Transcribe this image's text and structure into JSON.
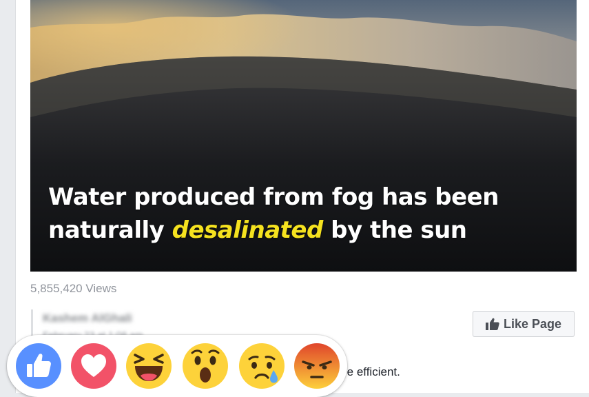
{
  "video": {
    "caption_before": "Water produced from fog has been naturally",
    "caption_highlight": "desalinated",
    "caption_after": "by the sun"
  },
  "views": "5,855,420 Views",
  "author": {
    "name": "Kashem AlGhali",
    "date": "February 23 at 1:08 am"
  },
  "like_page_button": "Like Page",
  "body_text_fragment": "re efficient.",
  "reactions": [
    {
      "name": "like",
      "icon": "like-reaction-icon",
      "color": "#5890ff"
    },
    {
      "name": "love",
      "icon": "love-reaction-icon",
      "color": "#f25268"
    },
    {
      "name": "haha",
      "icon": "haha-reaction-icon",
      "color": "#fdd23a"
    },
    {
      "name": "wow",
      "icon": "wow-reaction-icon",
      "color": "#fdd23a"
    },
    {
      "name": "sad",
      "icon": "sad-reaction-icon",
      "color": "#fdd23a"
    },
    {
      "name": "angry",
      "icon": "angry-reaction-icon",
      "color": "#f26b2e"
    }
  ],
  "colors": {
    "caption_highlight": "#f5e21f",
    "muted_text": "#90949c",
    "button_bg": "#f6f7f9"
  }
}
